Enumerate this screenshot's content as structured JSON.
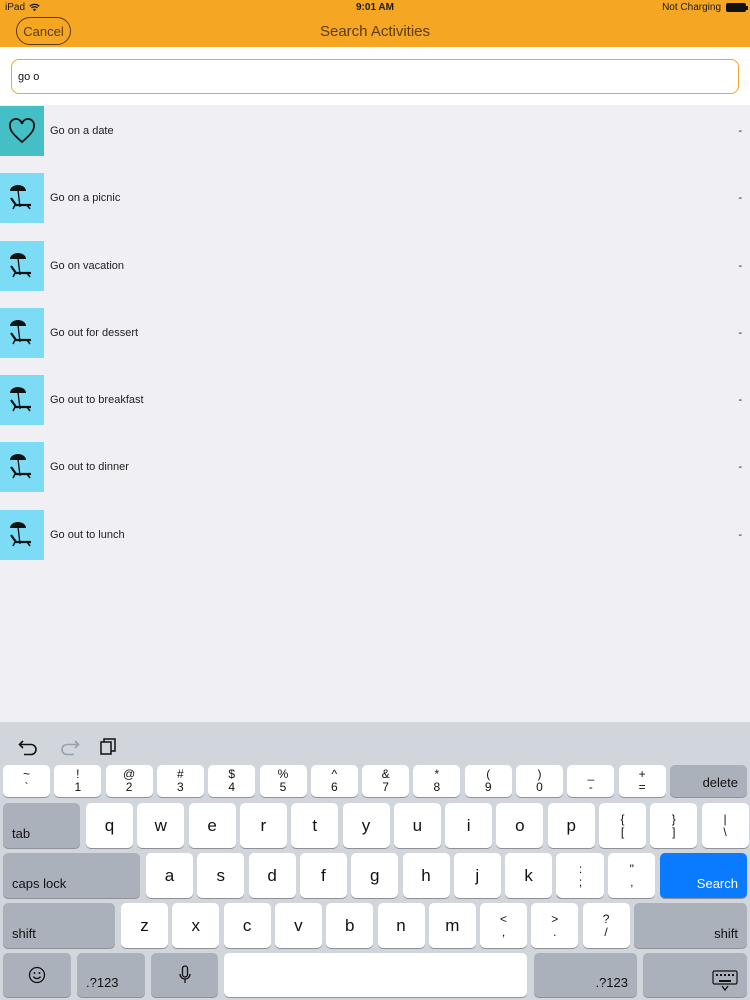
{
  "status": {
    "device": "iPad",
    "time": "9:01 AM",
    "battery": "Not Charging"
  },
  "nav": {
    "cancel_label": "Cancel",
    "title": "Search Activities"
  },
  "search": {
    "value": "go o",
    "placeholder": ""
  },
  "results": [
    {
      "label": "Go on a date",
      "value": "-",
      "icon": "heart-icon",
      "color": "#44bfc6"
    },
    {
      "label": "Go on a picnic",
      "value": "-",
      "icon": "beach-chair-icon",
      "color": "#7cdcf5"
    },
    {
      "label": "Go on vacation",
      "value": "-",
      "icon": "beach-chair-icon",
      "color": "#7cdcf5"
    },
    {
      "label": "Go out for dessert",
      "value": "-",
      "icon": "beach-chair-icon",
      "color": "#7cdcf5"
    },
    {
      "label": "Go out to breakfast",
      "value": "-",
      "icon": "beach-chair-icon",
      "color": "#7cdcf5"
    },
    {
      "label": "Go out to dinner",
      "value": "-",
      "icon": "beach-chair-icon",
      "color": "#7cdcf5"
    },
    {
      "label": "Go out to lunch",
      "value": "-",
      "icon": "beach-chair-icon",
      "color": "#7cdcf5"
    }
  ],
  "keyboard": {
    "shortcuts": [
      "undo-icon",
      "redo-icon",
      "paste-icon"
    ],
    "number_row": [
      [
        "~",
        "`"
      ],
      [
        "!",
        "1"
      ],
      [
        "@",
        "2"
      ],
      [
        "#",
        "3"
      ],
      [
        "$",
        "4"
      ],
      [
        "%",
        "5"
      ],
      [
        "^",
        "6"
      ],
      [
        "&",
        "7"
      ],
      [
        "*",
        "8"
      ],
      [
        "(",
        "9"
      ],
      [
        ")",
        "0"
      ],
      [
        "_",
        "-"
      ],
      [
        "+",
        "="
      ]
    ],
    "delete_label": "delete",
    "tab_label": "tab",
    "row_q": [
      "q",
      "w",
      "e",
      "r",
      "t",
      "y",
      "u",
      "i",
      "o",
      "p"
    ],
    "row_q_punct": [
      [
        "{",
        "["
      ],
      [
        "}",
        "]"
      ],
      [
        "|",
        "\\"
      ]
    ],
    "caps_label": "caps lock",
    "row_a": [
      "a",
      "s",
      "d",
      "f",
      "g",
      "h",
      "j",
      "k",
      "l"
    ],
    "row_a_punct": [
      [
        ":",
        ";"
      ],
      [
        "\"",
        ","
      ]
    ],
    "search_label": "Search",
    "shift_label": "shift",
    "row_z": [
      "z",
      "x",
      "c",
      "v",
      "b",
      "n",
      "m"
    ],
    "row_z_punct": [
      [
        "<",
        ","
      ],
      [
        ">",
        "."
      ],
      [
        "?",
        "/"
      ]
    ],
    "numbers_label": ".?123"
  },
  "colors": {
    "accent": "#f5a623",
    "nav_text": "#5c3c07",
    "search_key": "#0a7bff"
  }
}
